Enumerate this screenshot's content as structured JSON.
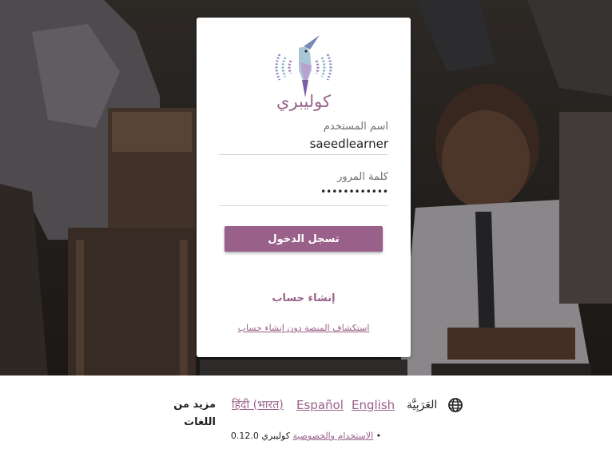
{
  "app": {
    "name": "كوليبري",
    "brand_color": "#996189"
  },
  "login": {
    "username_label": "اسم المستخدم",
    "username_value": "saeedlearner",
    "password_label": "كلمة المرور",
    "password_value": "••••••••••••",
    "signin_button": "تسجل الدخول",
    "create_account_link": "إنشاء حساب",
    "guest_link": "استكشاف المنصة دون إنشاء حساب"
  },
  "footer": {
    "globe_icon": "globe-icon",
    "current_language": "العَرَبِيَّة",
    "languages": [
      "English",
      "Español",
      "हिंदी (भारत)"
    ],
    "more_languages": "مزيد من اللغات",
    "version_prefix": "كوليبري 0.12.0 •",
    "privacy_link": "الاستخدام والخصوصية"
  }
}
